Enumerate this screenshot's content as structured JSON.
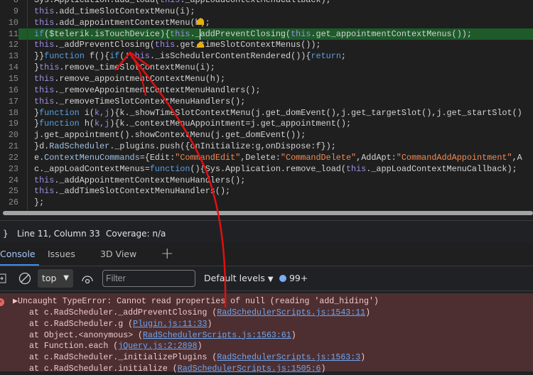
{
  "editor": {
    "highlighted_line": 11,
    "lines": [
      {
        "n": "8",
        "tokens": [
          [
            "id",
            "Sys.Application.add_load("
          ],
          [
            "kw",
            "this"
          ],
          [
            "id",
            "._appLoadContextMenuCallback);"
          ]
        ]
      },
      {
        "n": "9",
        "tokens": [
          [
            "kw",
            "this"
          ],
          [
            "id",
            ".add_timeSlotContextMenu(i);"
          ]
        ]
      },
      {
        "n": "10",
        "tokens": [
          [
            "kw",
            "this"
          ],
          [
            "id",
            ".add_appointmentContextMenu(h);"
          ]
        ]
      },
      {
        "n": "11",
        "tokens": [
          [
            "fn",
            "if"
          ],
          [
            "id",
            "($telerik.isTouchDevice){"
          ],
          [
            "kw",
            "this"
          ],
          [
            "id",
            "._addPreventClosing("
          ],
          [
            "kw",
            "this"
          ],
          [
            "id",
            ".get_appointmentContextMenus());"
          ]
        ]
      },
      {
        "n": "12",
        "tokens": [
          [
            "kw",
            "this"
          ],
          [
            "id",
            "._addPreventClosing("
          ],
          [
            "kw",
            "this"
          ],
          [
            "id",
            ".get_timeSlotContextMenus());"
          ]
        ]
      },
      {
        "n": "13",
        "tokens": [
          [
            "id",
            "}}"
          ],
          [
            "fn",
            "function"
          ],
          [
            "id",
            " f(){"
          ],
          [
            "fn",
            "if"
          ],
          [
            "id",
            "(!"
          ],
          [
            "kw",
            "this"
          ],
          [
            "id",
            "._isSchedulerContentRendered()){"
          ],
          [
            "fn",
            "return"
          ],
          [
            "id",
            ";"
          ]
        ]
      },
      {
        "n": "14",
        "tokens": [
          [
            "id",
            "}"
          ],
          [
            "kw",
            "this"
          ],
          [
            "id",
            ".remove_timeSlotContextMenu(i);"
          ]
        ]
      },
      {
        "n": "15",
        "tokens": [
          [
            "kw",
            "this"
          ],
          [
            "id",
            ".remove_appointmentContextMenu(h);"
          ]
        ]
      },
      {
        "n": "16",
        "tokens": [
          [
            "kw",
            "this"
          ],
          [
            "id",
            "._removeAppointmentContextMenuHandlers();"
          ]
        ]
      },
      {
        "n": "17",
        "tokens": [
          [
            "kw",
            "this"
          ],
          [
            "id",
            "._removeTimeSlotContextMenuHandlers();"
          ]
        ]
      },
      {
        "n": "18",
        "tokens": [
          [
            "id",
            "}"
          ],
          [
            "fn",
            "function"
          ],
          [
            "id",
            " i("
          ],
          [
            "kw",
            "k,j"
          ],
          [
            "id",
            "){k._showTimeSlotContextMenu(j.get_domEvent(),j.get_targetSlot(),j.get_startSlot()"
          ]
        ]
      },
      {
        "n": "19",
        "tokens": [
          [
            "id",
            "}"
          ],
          [
            "fn",
            "function"
          ],
          [
            "id",
            " h("
          ],
          [
            "kw",
            "k,j"
          ],
          [
            "id",
            "){k._contextMenuAppointment=j.get_appointment();"
          ]
        ]
      },
      {
        "n": "20",
        "tokens": [
          [
            "id",
            "j.get_appointment().showContextMenu(j.get_domEvent());"
          ]
        ]
      },
      {
        "n": "21",
        "tokens": [
          [
            "id",
            "}d."
          ],
          [
            "type",
            "RadScheduler"
          ],
          [
            "id",
            "._plugins.push({onInitialize:g,onDispose:f});"
          ]
        ]
      },
      {
        "n": "22",
        "tokens": [
          [
            "id",
            "e."
          ],
          [
            "type",
            "ContextMenuCommands"
          ],
          [
            "id",
            "={Edit:"
          ],
          [
            "str",
            "\"CommandEdit\""
          ],
          [
            "id",
            ",Delete:"
          ],
          [
            "str",
            "\"CommandDelete\""
          ],
          [
            "id",
            ",AddApt:"
          ],
          [
            "str",
            "\"CommandAddAppointment\""
          ],
          [
            "id",
            ",A"
          ]
        ]
      },
      {
        "n": "23",
        "tokens": [
          [
            "id",
            "c._appLoadContextMenus="
          ],
          [
            "fn",
            "function"
          ],
          [
            "id",
            "(){Sys.Application.remove_load("
          ],
          [
            "kw",
            "this"
          ],
          [
            "id",
            "._appLoadContextMenuCallback);"
          ]
        ]
      },
      {
        "n": "24",
        "tokens": [
          [
            "kw",
            "this"
          ],
          [
            "id",
            "._addAppointmentContextMenuHandlers();"
          ]
        ]
      },
      {
        "n": "25",
        "tokens": [
          [
            "kw",
            "this"
          ],
          [
            "id",
            "._addTimeSlotContextMenuHandlers();"
          ]
        ]
      },
      {
        "n": "26",
        "tokens": [
          [
            "id",
            "};"
          ]
        ]
      }
    ]
  },
  "status": {
    "brace": "}",
    "position": "Line 11, Column 33",
    "coverage": "Coverage: n/a"
  },
  "tabs": [
    {
      "label": "Console",
      "active": true
    },
    {
      "label": "Issues"
    },
    {
      "label": "3D View"
    }
  ],
  "add_tab_label": "+",
  "toolbar": {
    "context": "top",
    "filter_placeholder": "Filter",
    "levels": "Default levels",
    "message_count": "99+"
  },
  "error": {
    "message": "Uncaught TypeError: Cannot read properties of null (reading 'add_hiding')",
    "stack": [
      {
        "prefix": "at c.RadScheduler._addPreventClosing (",
        "link": "RadSchedulerScripts.js:1543:11",
        "suffix": ")"
      },
      {
        "prefix": "at c.RadScheduler.g (",
        "link": "Plugin.js:11:33",
        "suffix": ")"
      },
      {
        "prefix": "at Object.<anonymous> (",
        "link": "RadSchedulerScripts.js:1563:61",
        "suffix": ")"
      },
      {
        "prefix": "at Function.each (",
        "link": "jQuery.js:2:2898",
        "suffix": ")"
      },
      {
        "prefix": "at c.RadScheduler._initializePlugins (",
        "link": "RadSchedulerScripts.js:1563:3",
        "suffix": ")"
      },
      {
        "prefix": "at c.RadScheduler.initialize (",
        "link": "RadSchedulerScripts.js:1505:6",
        "suffix": ")"
      }
    ]
  },
  "colors": {
    "highlight": "#1e5a2a",
    "error_bg": "#4d2f31",
    "annotation": "#e01010",
    "breakpoint": "#e8b10a"
  }
}
